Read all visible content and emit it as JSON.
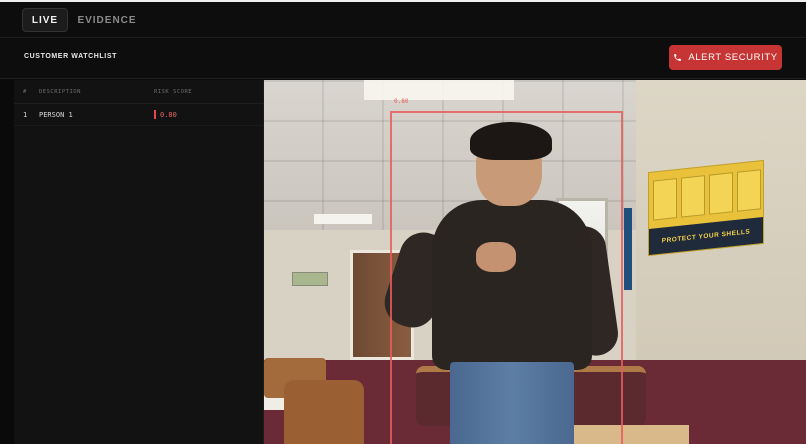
{
  "tabs": [
    {
      "label": "LIVE",
      "active": true
    },
    {
      "label": "EVIDENCE",
      "active": false
    }
  ],
  "header": {
    "title": "CUSTOMER WATCHLIST",
    "alert_button": {
      "label": "ALERT SECURITY",
      "icon": "phone-icon",
      "color": "#c63434"
    }
  },
  "watchlist": {
    "columns": [
      "#",
      "DESCRIPTION",
      "RISK SCORE"
    ],
    "rows": [
      {
        "index": "1",
        "description": "PERSON 1",
        "risk_score": "0.80"
      }
    ]
  },
  "feed": {
    "detection_label": "0.80",
    "poster_text": "PROTECT YOUR SHELLS"
  },
  "colors": {
    "accent_red": "#c63434",
    "risk_red": "#e24a4a",
    "background": "#0a0a0a"
  }
}
